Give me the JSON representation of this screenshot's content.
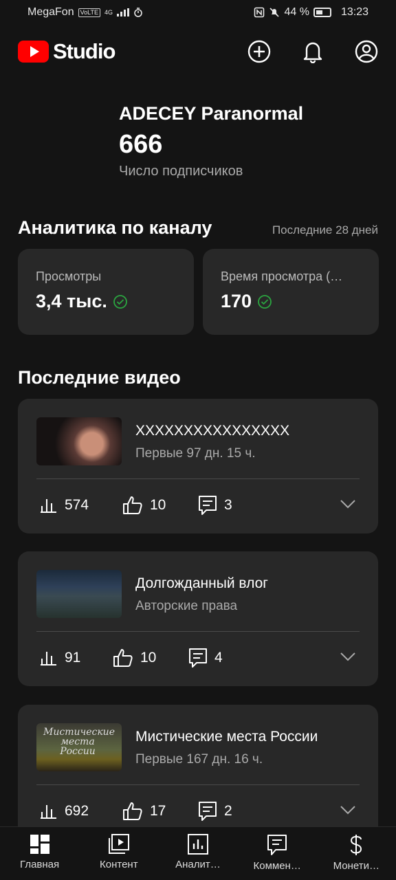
{
  "status_bar": {
    "carrier": "MegaFon",
    "volte": "VoLTE",
    "network": "4G",
    "battery": "44 %",
    "time": "13:23"
  },
  "app": {
    "logo_text": "Studio",
    "brand_color": "#ff0000",
    "actions": [
      "create-icon",
      "notifications-icon",
      "account-icon"
    ]
  },
  "channel": {
    "name": "ADECEY Paranormal",
    "subscribers": "666",
    "subscribers_label": "Число подписчиков"
  },
  "analytics": {
    "title": "Аналитика по каналу",
    "period": "Последние 28 дней",
    "cards": [
      {
        "label": "Просмотры",
        "value": "3,4 тыс."
      },
      {
        "label": "Время просмотра (…",
        "value": "170"
      }
    ]
  },
  "recent_videos": {
    "title": "Последние видео",
    "items": [
      {
        "title": "XXXXXXXXXXXXXXXX",
        "status": "Первые 97 дн. 15 ч.",
        "views": "574",
        "likes": "10",
        "comments": "3"
      },
      {
        "title": "Долгожданный влог",
        "status": "Авторские права",
        "views": "91",
        "likes": "10",
        "comments": "4"
      },
      {
        "title": "Мистические места России",
        "status": "Первые 167 дн. 16 ч.",
        "views": "692",
        "likes": "17",
        "comments": "2",
        "thumb_text": "Мистические места России"
      }
    ]
  },
  "bottom_nav": [
    {
      "label": "Главная",
      "icon": "dashboard-icon"
    },
    {
      "label": "Контент",
      "icon": "content-icon"
    },
    {
      "label": "Аналит…",
      "icon": "analytics-icon"
    },
    {
      "label": "Коммен…",
      "icon": "comments-icon"
    },
    {
      "label": "Монети…",
      "icon": "monetization-icon"
    }
  ]
}
